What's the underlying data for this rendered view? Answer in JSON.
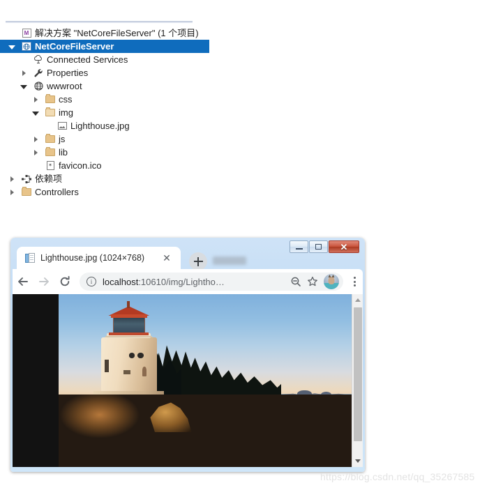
{
  "solution_explorer": {
    "name": "solution-explorer",
    "tree": [
      {
        "id": "solution",
        "label": "解决方案 \"NetCoreFileServer\" (1 个项目)",
        "icon": "solution-icon",
        "indent": 0,
        "expander": "none",
        "selected": false
      },
      {
        "id": "project",
        "label": "NetCoreFileServer",
        "icon": "project-web-icon",
        "indent": 0,
        "expander": "expanded",
        "selected": true
      },
      {
        "id": "connected-services",
        "label": "Connected Services",
        "icon": "connected-services-icon",
        "indent": 1,
        "expander": "none",
        "selected": false
      },
      {
        "id": "properties",
        "label": "Properties",
        "icon": "wrench-icon",
        "indent": 1,
        "expander": "collapsed",
        "selected": false
      },
      {
        "id": "wwwroot",
        "label": "wwwroot",
        "icon": "globe-icon",
        "indent": 1,
        "expander": "expanded",
        "selected": false
      },
      {
        "id": "css",
        "label": "css",
        "icon": "folder-icon",
        "indent": 2,
        "expander": "collapsed",
        "selected": false
      },
      {
        "id": "img",
        "label": "img",
        "icon": "folder-open-icon",
        "indent": 2,
        "expander": "expanded",
        "selected": false
      },
      {
        "id": "lighthouse-jpg",
        "label": "Lighthouse.jpg",
        "icon": "image-file-icon",
        "indent": 3,
        "expander": "none",
        "selected": false
      },
      {
        "id": "js",
        "label": "js",
        "icon": "folder-icon",
        "indent": 2,
        "expander": "collapsed",
        "selected": false
      },
      {
        "id": "lib",
        "label": "lib",
        "icon": "folder-icon",
        "indent": 2,
        "expander": "collapsed",
        "selected": false
      },
      {
        "id": "favicon-ico",
        "label": "favicon.ico",
        "icon": "ico-file-icon",
        "indent": 2,
        "expander": "none",
        "selected": false
      },
      {
        "id": "dependencies",
        "label": "依赖项",
        "icon": "dependencies-icon",
        "indent": 0,
        "expander": "collapsed",
        "selected": false
      },
      {
        "id": "controllers",
        "label": "Controllers",
        "icon": "folder-icon",
        "indent": 0,
        "expander": "collapsed",
        "selected": false
      }
    ],
    "selected_color": "#0f6cbd"
  },
  "browser": {
    "name": "chrome-window",
    "window_controls": {
      "minimize": "minimize-button",
      "maximize": "maximize-button",
      "close_glyph": "✕"
    },
    "tab": {
      "title": "Lighthouse.jpg (1024×768)",
      "close_glyph": "✕",
      "favicon": "image-document-icon"
    },
    "new_tab_label": "+",
    "toolbar": {
      "back": "back-arrow-icon",
      "forward": "forward-arrow-icon",
      "reload": "reload-icon",
      "url_host": "localhost",
      "url_rest": ":10610/img/Lightho…",
      "site_info": "info-icon",
      "zoom_out": "zoom-out-icon",
      "bookmark": "star-icon",
      "profile": "profile-avatar",
      "menu": "three-dot-menu-icon"
    },
    "content": {
      "image_name": "lighthouse-photo",
      "background": "#121212"
    },
    "scrollbar": {
      "up": "scroll-up-arrow",
      "down": "scroll-down-arrow",
      "thumb": "scroll-thumb"
    }
  },
  "watermark": {
    "text": "https://blog.csdn.net/qq_35267585"
  }
}
